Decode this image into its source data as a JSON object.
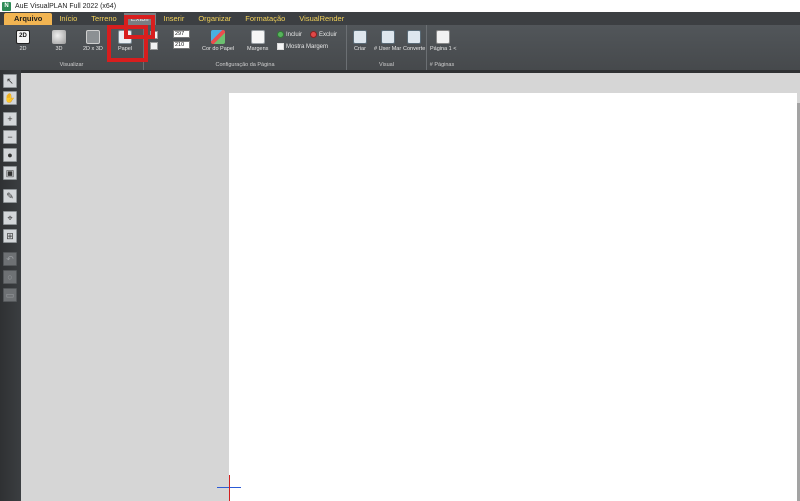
{
  "window": {
    "title": "AuE VisualPLAN Full 2022 (x64)",
    "icon_letter": "N"
  },
  "ribbon": {
    "tabs": [
      {
        "label": "Arquivo"
      },
      {
        "label": "Início"
      },
      {
        "label": "Terreno"
      },
      {
        "label": "Exibir"
      },
      {
        "label": "Inserir"
      },
      {
        "label": "Organizar"
      },
      {
        "label": "Formatação"
      },
      {
        "label": "VisualRender"
      }
    ],
    "active_tab": "Exibir",
    "highlight_color": "#d81e1e",
    "groups": {
      "visualizar": {
        "label": "Visualizar",
        "buttons": {
          "b2d": "2D",
          "b3d": "3D",
          "b2dx3d": "2D x 3D",
          "paper": "Papel"
        }
      },
      "config": {
        "label": "Configuração da Página",
        "width_value": "297",
        "height_value": "210",
        "paper_color": "Cor do Papel",
        "margins": "Margens",
        "include": "Incluir",
        "exclude": "Excluir",
        "show_margin": "Mostra Margem"
      },
      "visual": {
        "label": "Visual",
        "buttons": {
          "create": "Criar",
          "user_mar": "# User Mar",
          "convert": "Converte"
        }
      },
      "pages": {
        "label": "# Páginas",
        "page_button": "Página 1 <"
      }
    }
  },
  "toolbar": {
    "tools": [
      {
        "name": "select-arrow-icon",
        "glyph": "↖"
      },
      {
        "name": "pan-hand-icon",
        "glyph": "✋"
      },
      {
        "name": "zoom-in-icon",
        "glyph": "+"
      },
      {
        "name": "zoom-out-icon",
        "glyph": "−"
      },
      {
        "name": "zoom-full-icon",
        "glyph": "●"
      },
      {
        "name": "zoom-window-icon",
        "glyph": "▣"
      },
      {
        "name": "measure-icon",
        "glyph": "✎"
      },
      {
        "name": "snap-point-icon",
        "glyph": "⌖"
      },
      {
        "name": "grid-snap-icon",
        "glyph": "⊞"
      },
      {
        "name": "undo-shape-icon",
        "glyph": "↶"
      },
      {
        "name": "circle-shape-icon",
        "glyph": "○"
      },
      {
        "name": "rect-shape-icon",
        "glyph": "▭"
      }
    ]
  }
}
